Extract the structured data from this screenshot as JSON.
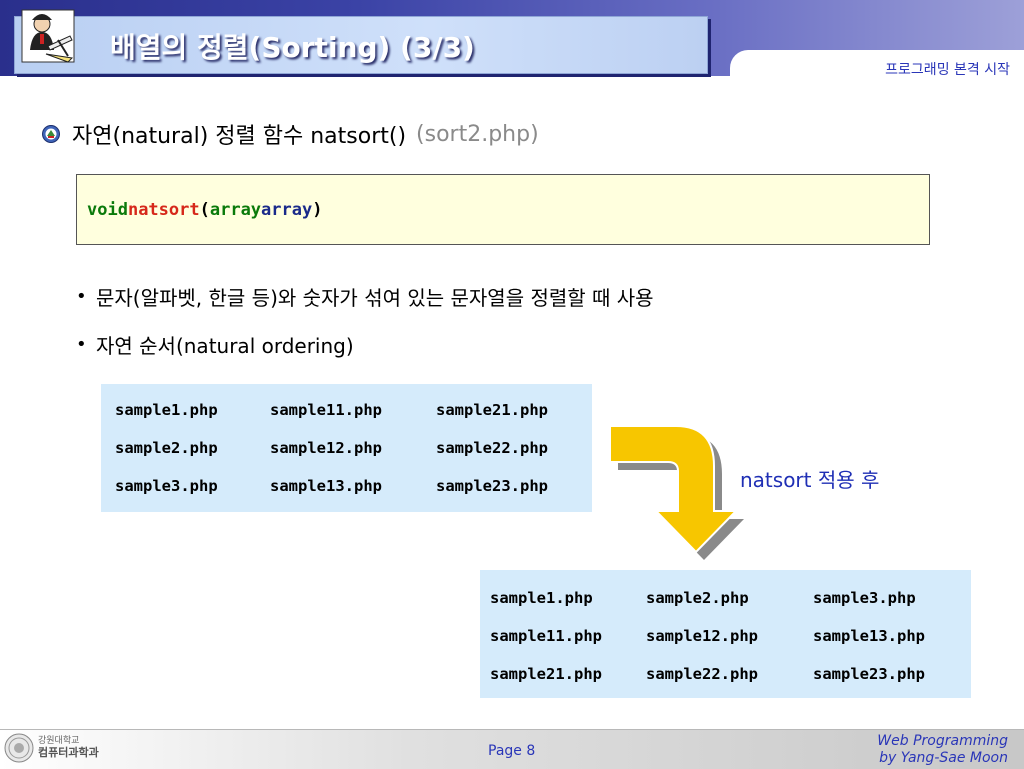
{
  "header": {
    "title": "배열의 정렬(Sorting) (3/3)",
    "subtitle": "프로그래밍 본격 시작"
  },
  "main_bullet": {
    "text": "자연(natural) 정렬 함수 natsort()",
    "file_hint": "(sort2.php)"
  },
  "code_box": {
    "tokens": {
      "t1": "void",
      "t2": "natsort",
      "t3": "(",
      "t4": "array",
      "t5": "array",
      "t6": ")"
    }
  },
  "sub_bullets": [
    "문자(알파벳, 한글 등)와 숫자가 섞여 있는 문자열을 정렬할 때 사용",
    "자연 순서(natural ordering)"
  ],
  "before_grid": {
    "rows": [
      [
        "sample1.php",
        "sample11.php",
        "sample21.php"
      ],
      [
        "sample2.php",
        "sample12.php",
        "sample22.php"
      ],
      [
        "sample3.php",
        "sample13.php",
        "sample23.php"
      ]
    ]
  },
  "after_label": "natsort 적용 후",
  "after_grid": {
    "rows": [
      [
        "sample1.php",
        "sample2.php",
        "sample3.php"
      ],
      [
        "sample11.php",
        "sample12.php",
        "sample13.php"
      ],
      [
        "sample21.php",
        "sample22.php",
        "sample23.php"
      ]
    ]
  },
  "footer": {
    "logo_line1": "강원대학교",
    "logo_line2": "컴퓨터과학과",
    "page": "Page 8",
    "credit_line1": "Web Programming",
    "credit_line2": "by Yang-Sae Moon"
  },
  "colors": {
    "header_dark": "#2a2f8c",
    "title_box": "#cfe0fa",
    "code_box_bg": "#ffffde",
    "grid_bg": "#d5ebfb",
    "accent_blue": "#1f2fb5",
    "arrow_yellow": "#f7c600"
  },
  "icons": {
    "title_icon": "professor-at-desk-icon",
    "bullet_icon": "university-emblem-icon",
    "arrow_icon": "curved-down-arrow-icon",
    "footer_logo": "university-seal-icon"
  }
}
